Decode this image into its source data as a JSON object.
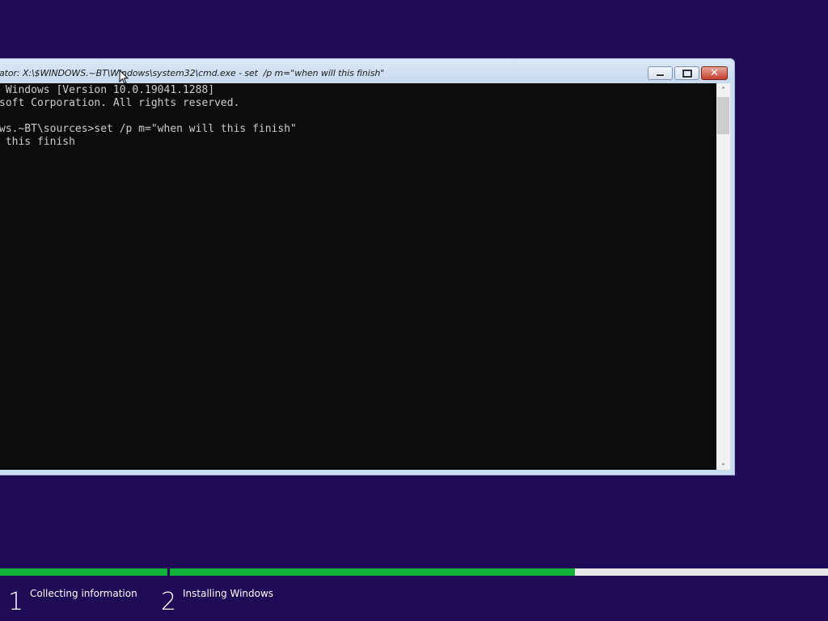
{
  "window": {
    "title": "ator: X:\\$WINDOWS.~BT\\Windows\\system32\\cmd.exe - set  /p m=\"when will this finish\"",
    "minimize_icon": "minimize-icon",
    "maximize_icon": "maximize-icon",
    "close_icon": "close-icon",
    "close_glyph": "✕"
  },
  "console": {
    "lines": [
      " Windows [Version 10.0.19041.1288]",
      "soft Corporation. All rights reserved.",
      "",
      "ws.~BT\\sources>set /p m=\"when will this finish\"",
      " this finish"
    ],
    "background_color": "#0c0c0c",
    "text_color": "#cccccc"
  },
  "scrollbar": {
    "up_glyph": "⌃",
    "down_glyph": "⌄"
  },
  "setup": {
    "background_color": "#1f0a55",
    "accent_color": "#10b23a",
    "steps": [
      {
        "number": "1",
        "label": "Collecting information",
        "progress": 1.0
      },
      {
        "number": "2",
        "label": "Installing Windows",
        "progress": 0.615
      }
    ]
  }
}
